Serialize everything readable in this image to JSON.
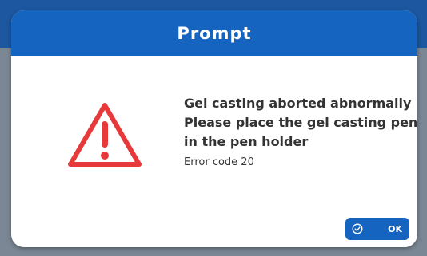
{
  "dialog": {
    "title": "Prompt",
    "icon": "warning-icon",
    "message_lines": [
      "Gel casting aborted abnormally",
      "Please place the gel casting pen",
      "in the pen holder"
    ],
    "error_code": "Error code  20",
    "ok_label": "OK",
    "ok_icon": "check-circle-icon"
  },
  "colors": {
    "header": "#1565c0",
    "warning": "#e8393a",
    "button": "#1565c0"
  }
}
